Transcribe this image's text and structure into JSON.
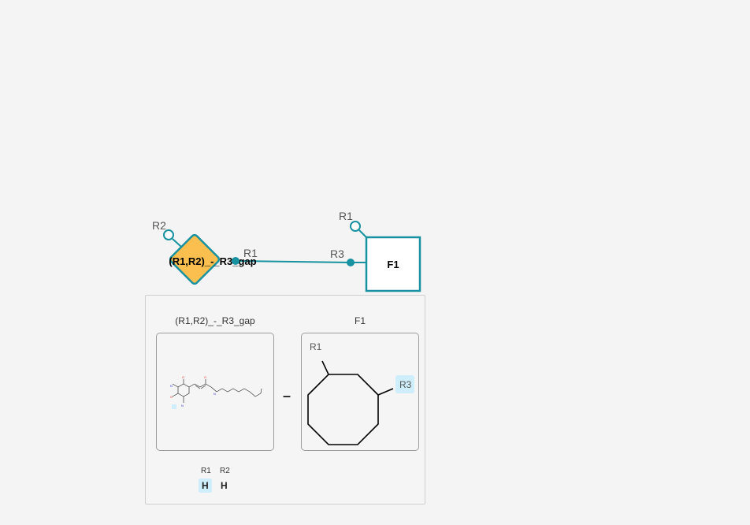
{
  "canvas": {
    "monomers": [
      {
        "id": "m1",
        "label": "(R1,R2)_-_R3_gap",
        "shape": "diamond",
        "fill": "#fbbf50",
        "stroke": "#1891a0",
        "attachment_labels": {
          "top_left": "R2",
          "right": "R1"
        }
      },
      {
        "id": "m2",
        "label": "F1",
        "shape": "square",
        "fill": "#ffffff",
        "stroke": "#1891a0",
        "attachment_labels": {
          "top_left": "R1",
          "left": "R3"
        }
      }
    ],
    "bond_color": "#1891a0"
  },
  "tooltip": {
    "left_title": "(R1,R2)_-_R3_gap",
    "right_title": "F1",
    "separator": "–",
    "right_structure_labels": {
      "r1": "R1",
      "r3": "R3"
    },
    "caps": [
      {
        "label": "R1",
        "value": "H",
        "highlighted": true
      },
      {
        "label": "R2",
        "value": "H",
        "highlighted": false
      }
    ]
  },
  "colors": {
    "accent": "#1891a0",
    "highlight": "#cdeefa",
    "monomer_fill": "#fbbf50"
  }
}
